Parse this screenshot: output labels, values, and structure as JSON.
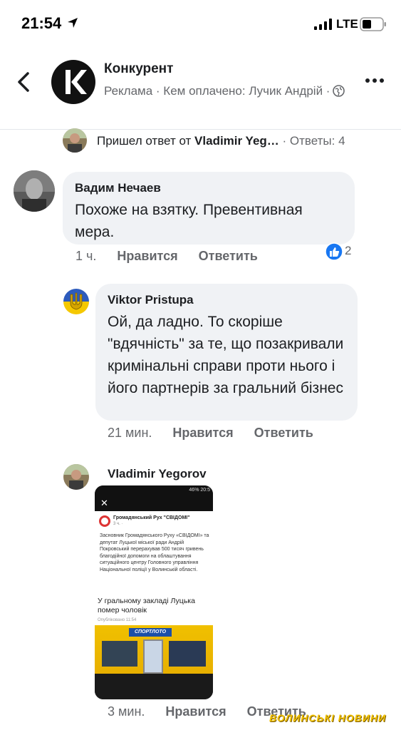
{
  "status_bar": {
    "time": "21:54",
    "network": "LTE",
    "icons": [
      "location-arrow-icon",
      "signal-icon",
      "battery-icon"
    ]
  },
  "header": {
    "page_name": "Конкурент",
    "ad_line": "Реклама · Кем оплачено: Лучик Андрій ·",
    "icons": [
      "back-icon",
      "globe-icon",
      "more-icon"
    ]
  },
  "replies_row": {
    "prefix": "Пришел ответ от ",
    "name": "Vladimir Yeg…",
    "count": " · Ответы: 4"
  },
  "comments": [
    {
      "author": "Вадим Нечаев",
      "text": "Похоже на взятку. Превентивная мера.",
      "time": "1 ч.",
      "like_label": "Нравится",
      "reply_label": "Ответить",
      "reactions": "2"
    },
    {
      "author": "Viktor Pristupa",
      "text": "Ой, да ладно. То скоріше \"вдячність\" за те, що позакривали кримінальні справи проти нього і його партнерів за гральний бізнес",
      "time": "21 мин.",
      "like_label": "Нравится",
      "reply_label": "Ответить"
    },
    {
      "author": "Vladimir Yegorov",
      "time": "3 мин.",
      "like_label": "Нравится",
      "reply_label": "Ответить"
    }
  ],
  "attachment": {
    "status": "46% 20:5",
    "close": "✕",
    "post_name": "Громадянський Рух \"СВІДОМІ\"",
    "post_time": "3 ч. ·",
    "post_body": "Засновник Громадянського Руху «СВІДОМІ» та депутат Луцької міської ради Андрій Покровський перерахував 500 тисяч гривень благодійної допомоги на облаштування ситуаційного центру Головного управління Національної поліції у Волинській області.",
    "link_title": "У гральному закладі Луцька помер чоловік",
    "link_date": "Опубліковано 11:54",
    "shop_sign": "СПОРТЛОТО"
  },
  "watermark": "ВОЛИНСЬКІ НОВИНИ",
  "colors": {
    "bubble": "#f0f2f5",
    "secondary_text": "#65676b",
    "like_blue": "#1877f2",
    "watermark": "#f2c200"
  }
}
